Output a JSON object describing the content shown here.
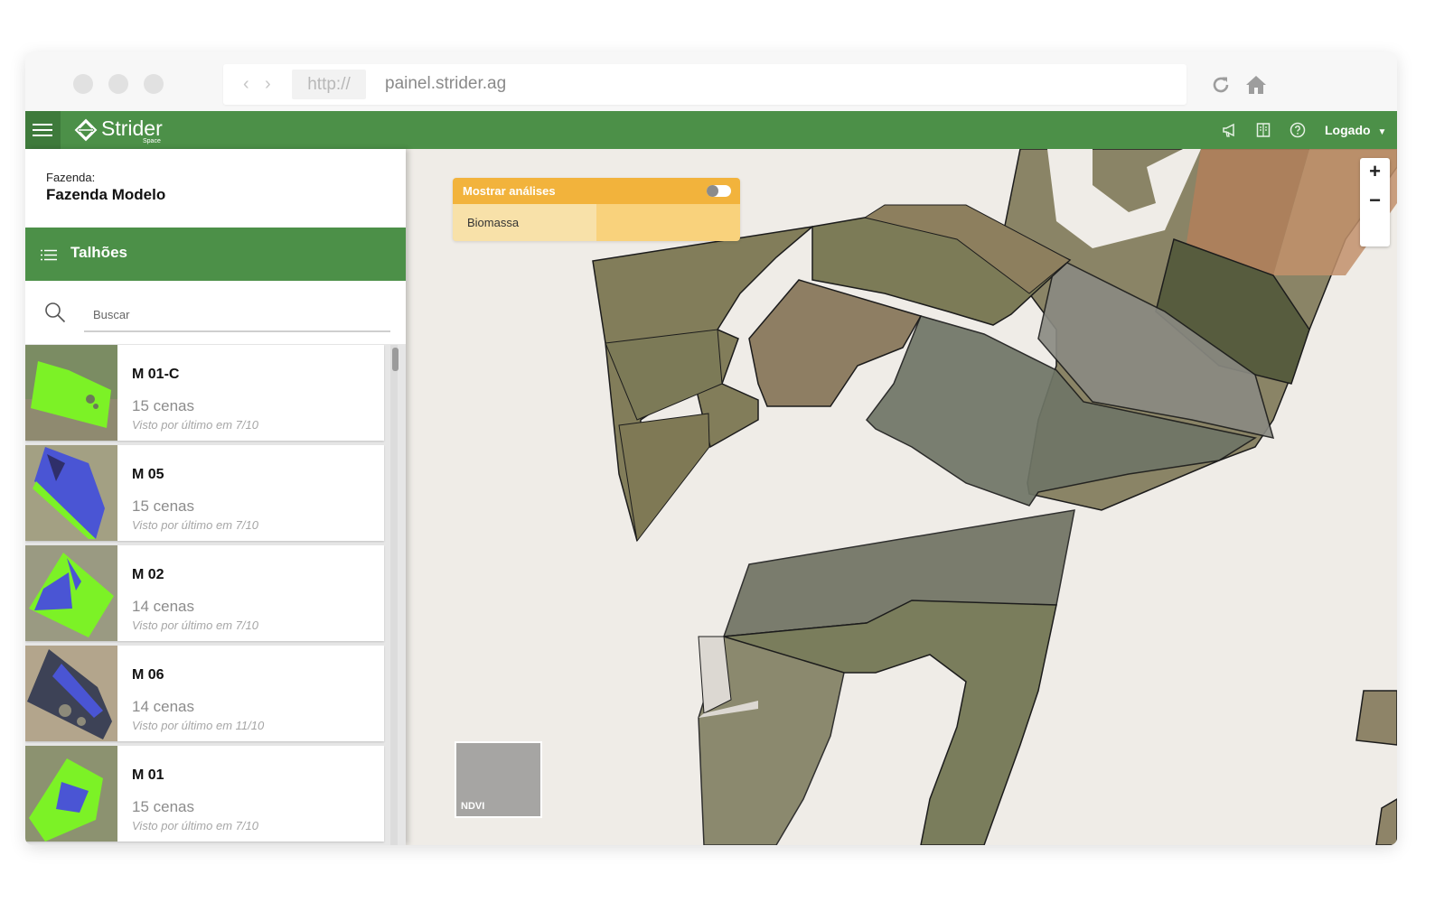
{
  "browser": {
    "protocol": "http://",
    "url": "painel.strider.ag",
    "back_icon": "chevron-left-icon",
    "forward_icon": "chevron-right-icon",
    "reload_icon": "reload-icon",
    "home_icon": "home-icon"
  },
  "appbar": {
    "brand": "Strider",
    "brand_sub": "Space",
    "user_label": "Logado",
    "color": "#4c9048",
    "icons": [
      "megaphone-icon",
      "book-icon",
      "help-icon",
      "caret-down-icon"
    ]
  },
  "sidebar": {
    "farm_label": "Fazenda:",
    "farm_name": "Fazenda Modelo",
    "plots_title": "Talhões",
    "search_placeholder": "Buscar",
    "items": [
      {
        "name": "M 01-C",
        "scenes": "15 cenas",
        "seen": "Visto por último em  7/10"
      },
      {
        "name": "M 05",
        "scenes": "15 cenas",
        "seen": "Visto por último em  7/10"
      },
      {
        "name": "M 02",
        "scenes": "14 cenas",
        "seen": "Visto por último em  7/10"
      },
      {
        "name": "M 06",
        "scenes": "14 cenas",
        "seen": "Visto por último em  11/10"
      },
      {
        "name": "M 01",
        "scenes": "15 cenas",
        "seen": "Visto por último em  7/10"
      }
    ]
  },
  "map": {
    "analysis_title": "Mostrar análises",
    "analysis_option": "Biomassa",
    "zoom_in": "+",
    "zoom_out": "−",
    "legend_label": "NDVI",
    "accent": "#f2b33c"
  }
}
